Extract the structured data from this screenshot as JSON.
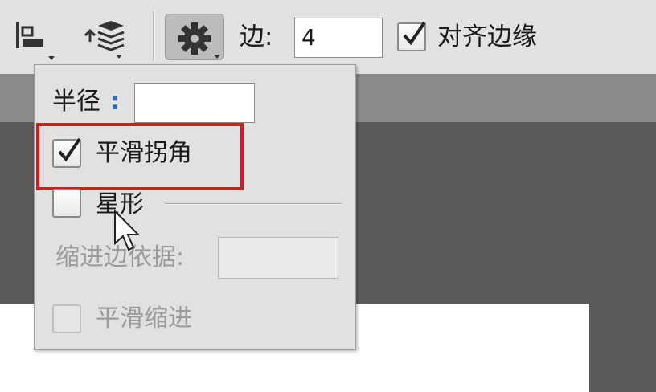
{
  "toolbar": {
    "edge_label": "边:",
    "edge_value": "4",
    "align_edges_label": "对齐边缘",
    "align_edges_checked": true,
    "icons": [
      "path-alignment-icon",
      "path-arrangement-icon",
      "gear-icon"
    ]
  },
  "popup": {
    "radius_label": "半径",
    "radius_colon": ":",
    "radius_value": "",
    "smooth_corners_label": "平滑拐角",
    "smooth_corners_checked": true,
    "star_label": "星形",
    "star_checked": false,
    "indent_label": "缩进边依据:",
    "indent_value": "",
    "smooth_indent_label": "平滑缩进",
    "smooth_indent_checked": false
  },
  "colors": {
    "highlight": "#e0161c",
    "toolbar_bg": "#e2e2e2",
    "popup_bg": "#e1e1e1",
    "disabled_text": "#9b9b9b"
  }
}
